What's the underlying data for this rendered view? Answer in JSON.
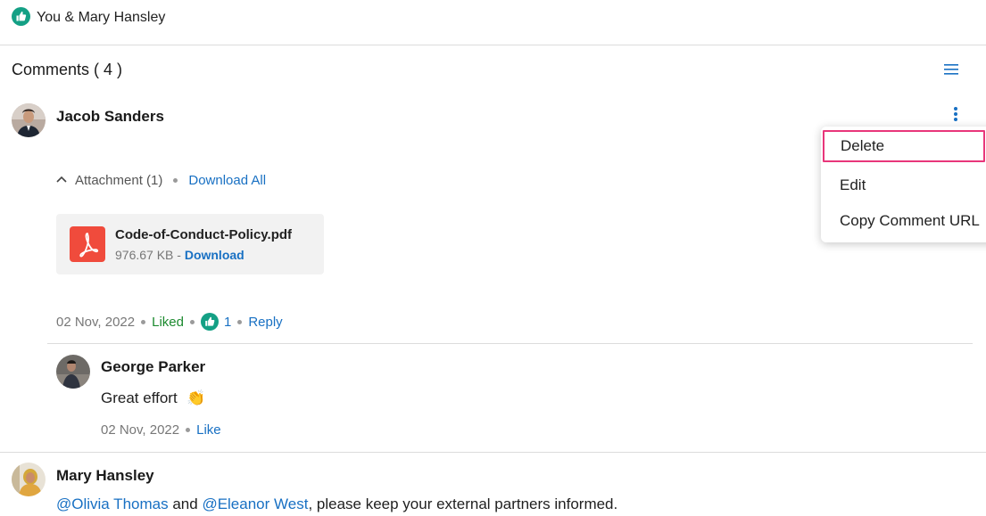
{
  "likes_bar": {
    "text": "You & Mary Hansley"
  },
  "comments": {
    "title": "Comments ( 4 )",
    "items": [
      {
        "author": "Jacob Sanders",
        "attachment": {
          "toggle_label": "Attachment (1)",
          "download_all": "Download All",
          "file": {
            "name": "Code-of-Conduct-Policy.pdf",
            "size": "976.67 KB -",
            "download": "Download"
          }
        },
        "date": "02 Nov, 2022",
        "liked": "Liked",
        "like_count": "1",
        "reply": "Reply",
        "replies": [
          {
            "author": "George Parker",
            "text": "Great effort",
            "emoji": "👏",
            "date": "02 Nov, 2022",
            "like": "Like"
          }
        ]
      },
      {
        "author": "Mary Hansley",
        "mention_1": "@Olivia Thomas",
        "and": "and",
        "mention_2": "@Eleanor West",
        "text_rest": ", please keep your external partners informed."
      }
    ]
  },
  "context_menu": {
    "items": [
      "Delete",
      "Edit",
      "Copy Comment URL"
    ]
  },
  "colors": {
    "like_green": "#14a085",
    "link_blue": "#1870c3",
    "liked_green": "#1c8a2f",
    "pdf_red": "#f04b3c",
    "highlight_pink": "#e8367a"
  }
}
